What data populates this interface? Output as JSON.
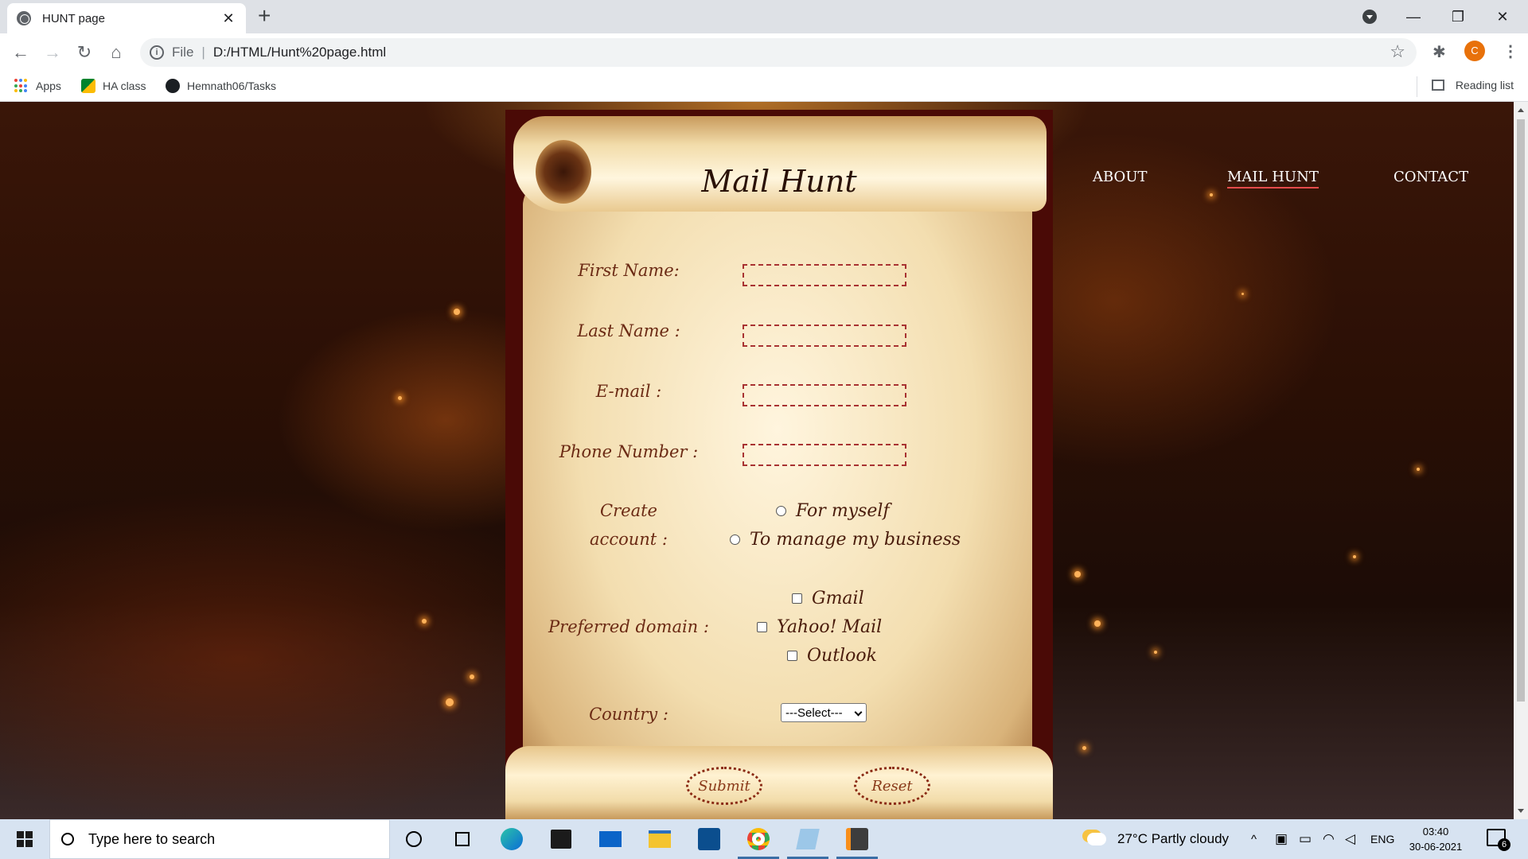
{
  "browser": {
    "tab_title": "HUNT page",
    "url_scheme": "File",
    "url": "D:/HTML/Hunt%20page.html",
    "avatar_letter": "C",
    "bookmarks": [
      "Apps",
      "HA class",
      "Hemnath06/Tasks"
    ],
    "reading_list": "Reading list"
  },
  "site": {
    "nav": [
      "ABOUT",
      "MAIL HUNT",
      "CONTACT"
    ],
    "active_nav": "MAIL HUNT",
    "heading": "Mail Hunt"
  },
  "form": {
    "first_name_label": "First Name:",
    "last_name_label": "Last Name :",
    "email_label": "E-mail :",
    "phone_label": "Phone Number :",
    "account_label_1": "Create",
    "account_label_2": "account :",
    "account_options": [
      "For myself",
      "To manage my business"
    ],
    "domain_label": "Preferred domain :",
    "domain_options": [
      "Gmail",
      "Yahoo! Mail",
      "Outlook"
    ],
    "country_label": "Country :",
    "country_selected": "---Select---",
    "submit_label": "Submit",
    "reset_label": "Reset"
  },
  "taskbar": {
    "search_placeholder": "Type here to search",
    "weather": "27°C  Partly cloudy",
    "language": "ENG",
    "time": "03:40",
    "date": "30-06-2021",
    "notification_count": "6"
  },
  "colors": {
    "accent_underline": "#e54b4b",
    "field_border": "#a83232",
    "taskbar_bg": "#d7e3f1"
  }
}
